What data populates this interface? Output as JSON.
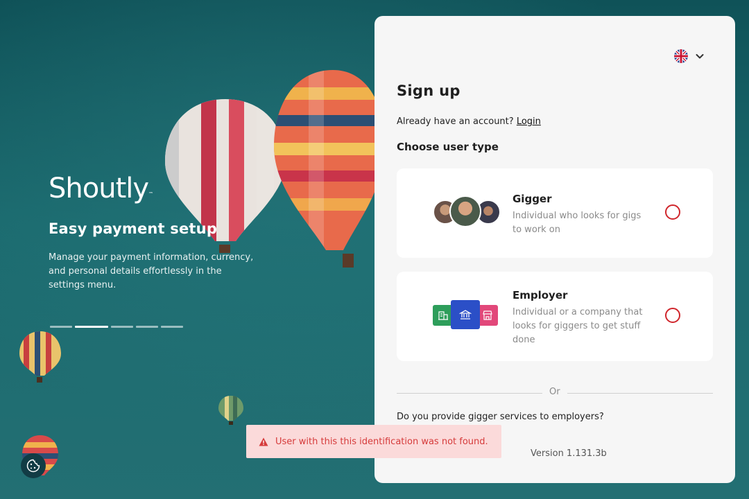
{
  "hero": {
    "logo": "Shoutly",
    "logo_mark": "™",
    "title": "Easy payment setup",
    "description": "Manage your payment information, currency, and personal details effortlessly in the settings menu."
  },
  "carousel": {
    "total": 5,
    "active_index": 1
  },
  "language": {
    "icon": "uk-flag-icon"
  },
  "signup": {
    "title": "Sign up",
    "already_account": "Already have an account?",
    "login_link": "Login",
    "choose_type": "Choose user type",
    "options": [
      {
        "title": "Gigger",
        "description": "Individual who looks for gigs to work on"
      },
      {
        "title": "Employer",
        "description": "Individual or a company that looks for giggers to get stuff done"
      }
    ],
    "or": "Or",
    "provide_question": "Do you provide gigger services to employers?",
    "version": "Version 1.131.3b"
  },
  "toast": {
    "message": "User with this this identification was not found."
  },
  "colors": {
    "accent": "#d0262c",
    "panel": "#f6f6f6",
    "toast_bg": "#fbdada",
    "toast_text": "#d63b3b"
  }
}
